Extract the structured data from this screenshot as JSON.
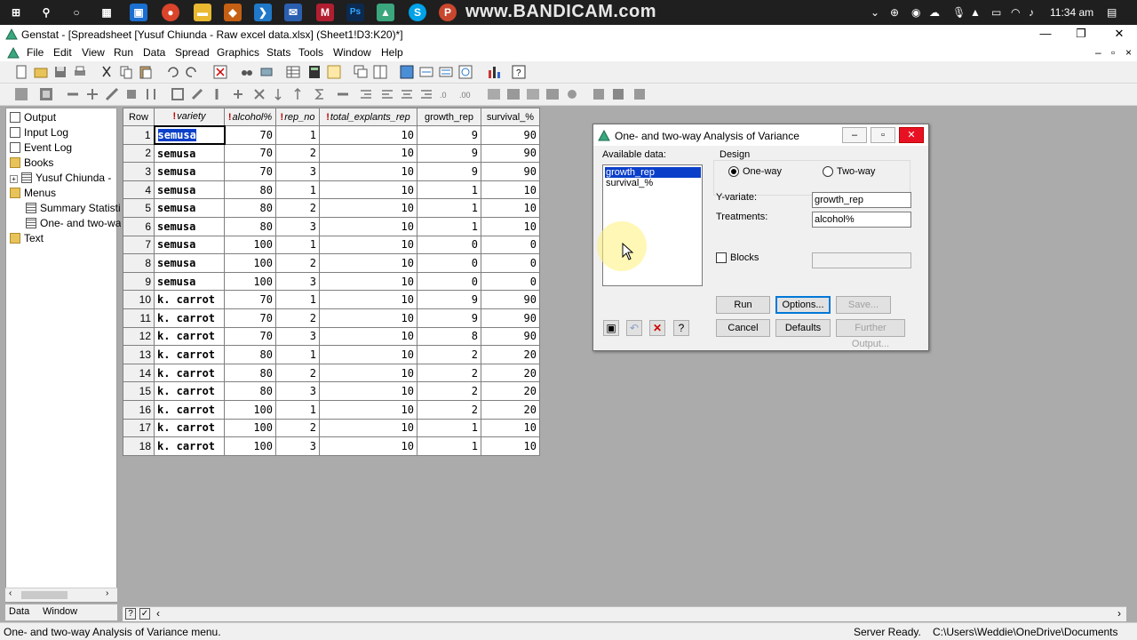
{
  "taskbar": {
    "watermark": "www.BANDICAM.com",
    "clock": "11:34 am"
  },
  "window": {
    "title": "Genstat   - [Spreadsheet [Yusuf Chiunda - Raw excel data.xlsx] (Sheet1!D3:K20)*]",
    "min": "—",
    "max": "❐",
    "close": "✕"
  },
  "menu": [
    "File",
    "Edit",
    "View",
    "Run",
    "Data",
    "Spread",
    "Graphics",
    "Stats",
    "Tools",
    "Window",
    "Help"
  ],
  "tree": {
    "output": "Output",
    "input_log": "Input Log",
    "event_log": "Event Log",
    "books": "Books",
    "book1": "Yusuf Chiunda -",
    "menus": "Menus",
    "menu1": "Summary Statisti",
    "menu2": "One- and two-wa",
    "text": "Text",
    "tab_data": "Data",
    "tab_window": "Window"
  },
  "sheet": {
    "headers": [
      "Row",
      "variety",
      "alcohol%",
      "rep_no",
      "total_explants_rep",
      "growth_rep",
      "survival_%"
    ],
    "rows": [
      [
        "1",
        "semusa",
        "70",
        "1",
        "10",
        "9",
        "90"
      ],
      [
        "2",
        "semusa",
        "70",
        "2",
        "10",
        "9",
        "90"
      ],
      [
        "3",
        "semusa",
        "70",
        "3",
        "10",
        "9",
        "90"
      ],
      [
        "4",
        "semusa",
        "80",
        "1",
        "10",
        "1",
        "10"
      ],
      [
        "5",
        "semusa",
        "80",
        "2",
        "10",
        "1",
        "10"
      ],
      [
        "6",
        "semusa",
        "80",
        "3",
        "10",
        "1",
        "10"
      ],
      [
        "7",
        "semusa",
        "100",
        "1",
        "10",
        "0",
        "0"
      ],
      [
        "8",
        "semusa",
        "100",
        "2",
        "10",
        "0",
        "0"
      ],
      [
        "9",
        "semusa",
        "100",
        "3",
        "10",
        "0",
        "0"
      ],
      [
        "10",
        "k. carrot",
        "70",
        "1",
        "10",
        "9",
        "90"
      ],
      [
        "11",
        "k. carrot",
        "70",
        "2",
        "10",
        "9",
        "90"
      ],
      [
        "12",
        "k. carrot",
        "70",
        "3",
        "10",
        "8",
        "90"
      ],
      [
        "13",
        "k. carrot",
        "80",
        "1",
        "10",
        "2",
        "20"
      ],
      [
        "14",
        "k. carrot",
        "80",
        "2",
        "10",
        "2",
        "20"
      ],
      [
        "15",
        "k. carrot",
        "80",
        "3",
        "10",
        "2",
        "20"
      ],
      [
        "16",
        "k. carrot",
        "100",
        "1",
        "10",
        "2",
        "20"
      ],
      [
        "17",
        "k. carrot",
        "100",
        "2",
        "10",
        "1",
        "10"
      ],
      [
        "18",
        "k. carrot",
        "100",
        "3",
        "10",
        "1",
        "10"
      ]
    ]
  },
  "dialog": {
    "title": "One- and two-way Analysis of Variance",
    "available_label": "Available data:",
    "available_items": [
      "growth_rep",
      "survival_%"
    ],
    "design_label": "Design",
    "oneway": "One-way",
    "twoway": "Two-way",
    "yvariate_label": "Y-variate:",
    "yvariate_value": "growth_rep",
    "treatments_label": "Treatments:",
    "treatments_value": "alcohol%",
    "blocks_label": "Blocks",
    "run": "Run",
    "options": "Options...",
    "save": "Save...",
    "cancel": "Cancel",
    "defaults": "Defaults",
    "further": "Further Output..."
  },
  "status": {
    "message": "One- and two-way Analysis of Variance menu.",
    "ready": "Server Ready.",
    "path": "C:\\Users\\Weddie\\OneDrive\\Documents"
  },
  "colors": {
    "selection": "#0a3fc9",
    "taskbar": "#1f1f1f",
    "close_red": "#e81123"
  }
}
